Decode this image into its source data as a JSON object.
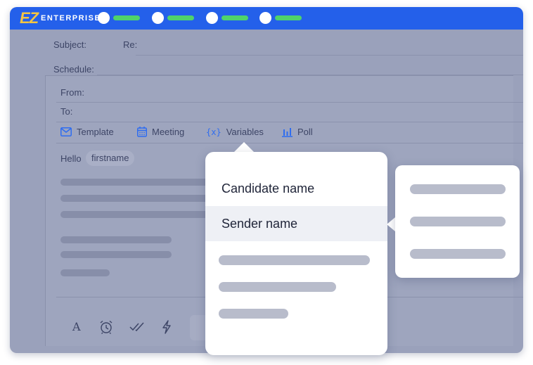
{
  "brand": {
    "mark": "EZ",
    "name": "ENTERPRISE"
  },
  "fields": {
    "subject_label": "Subject:",
    "re_label": "Re:",
    "schedule_label": "Schedule:",
    "from_label": "From:",
    "to_label": "To:"
  },
  "toolbar": [
    {
      "label": "Template",
      "icon": "mail-icon"
    },
    {
      "label": "Meeting",
      "icon": "calendar-icon"
    },
    {
      "label": "Variables",
      "icon": "braces-icon"
    },
    {
      "label": "Poll",
      "icon": "bar-chart-icon"
    }
  ],
  "body": {
    "greeting": "Hello",
    "variable_chip": "firstname"
  },
  "bottom_tools": [
    "text-format-icon",
    "alarm-clock-icon",
    "double-check-icon",
    "lightning-icon"
  ],
  "variables_menu": {
    "items": [
      {
        "label": "Candidate name",
        "active": false
      },
      {
        "label": "Sender name",
        "active": true
      }
    ]
  },
  "colors": {
    "topbar": "#2460ea",
    "logo_accent": "#f5c542",
    "progress": "#4fd36a",
    "overlay": "#9aa1bb",
    "toolbar_icon": "#2f6df0"
  }
}
